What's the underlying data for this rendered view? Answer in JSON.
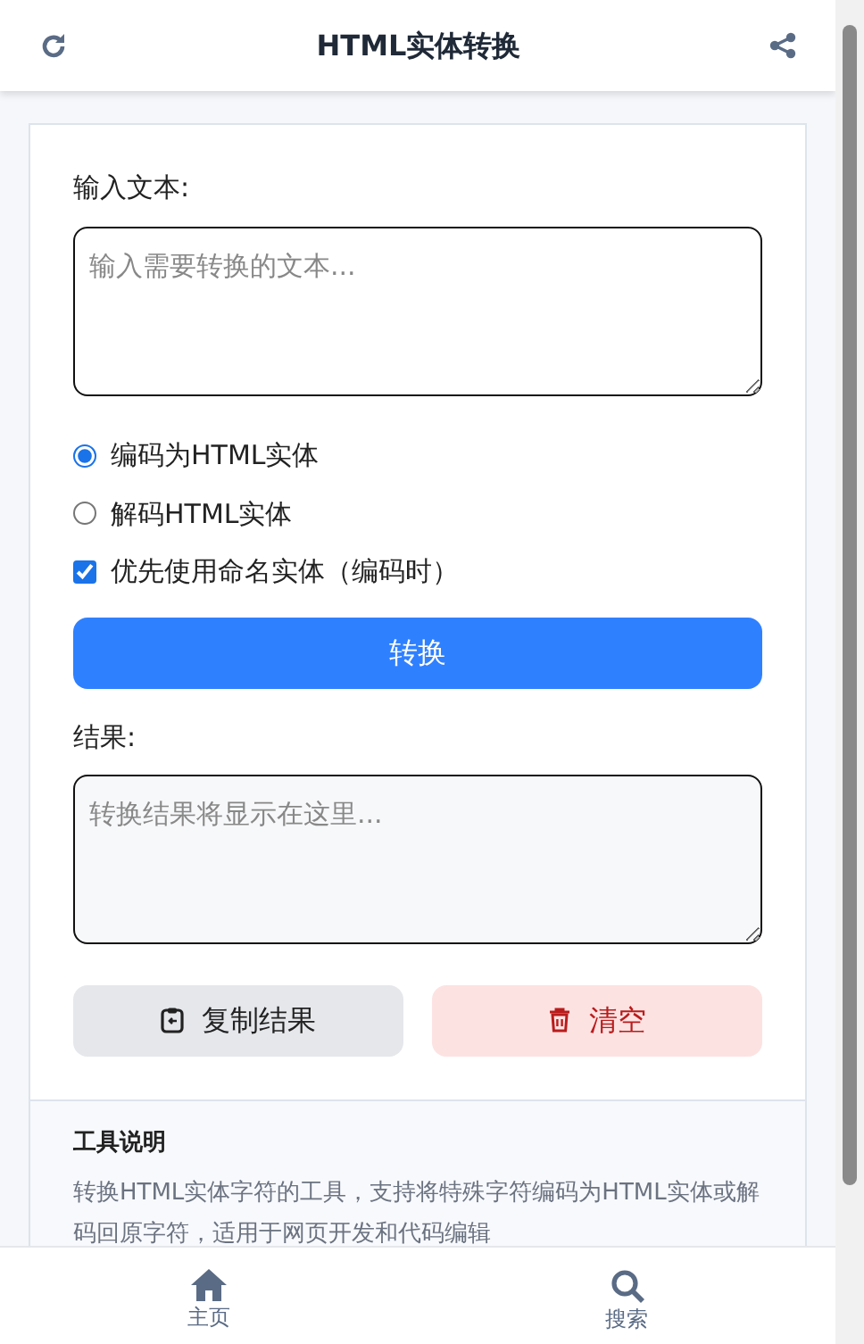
{
  "header": {
    "title": "HTML实体转换"
  },
  "input": {
    "label": "输入文本:",
    "placeholder": "输入需要转换的文本..."
  },
  "options": [
    {
      "kind": "radio",
      "label": "编码为HTML实体",
      "selected": true
    },
    {
      "kind": "radio",
      "label": "解码HTML实体",
      "selected": false
    },
    {
      "kind": "checkbox",
      "label": "优先使用命名实体（编码时）",
      "checked": true
    }
  ],
  "convert_button": "转换",
  "result": {
    "label": "结果:",
    "placeholder": "转换结果将显示在这里..."
  },
  "actions": [
    {
      "kind": "copy",
      "label": "复制结果"
    },
    {
      "kind": "clear",
      "label": "清空"
    }
  ],
  "info": {
    "title": "工具说明",
    "text": "转换HTML实体字符的工具，支持将特殊字符编码为HTML实体或解码回原字符，适用于网页开发和代码编辑"
  },
  "nav": [
    {
      "kind": "home",
      "label": "主页"
    },
    {
      "kind": "search",
      "label": "搜索"
    }
  ]
}
